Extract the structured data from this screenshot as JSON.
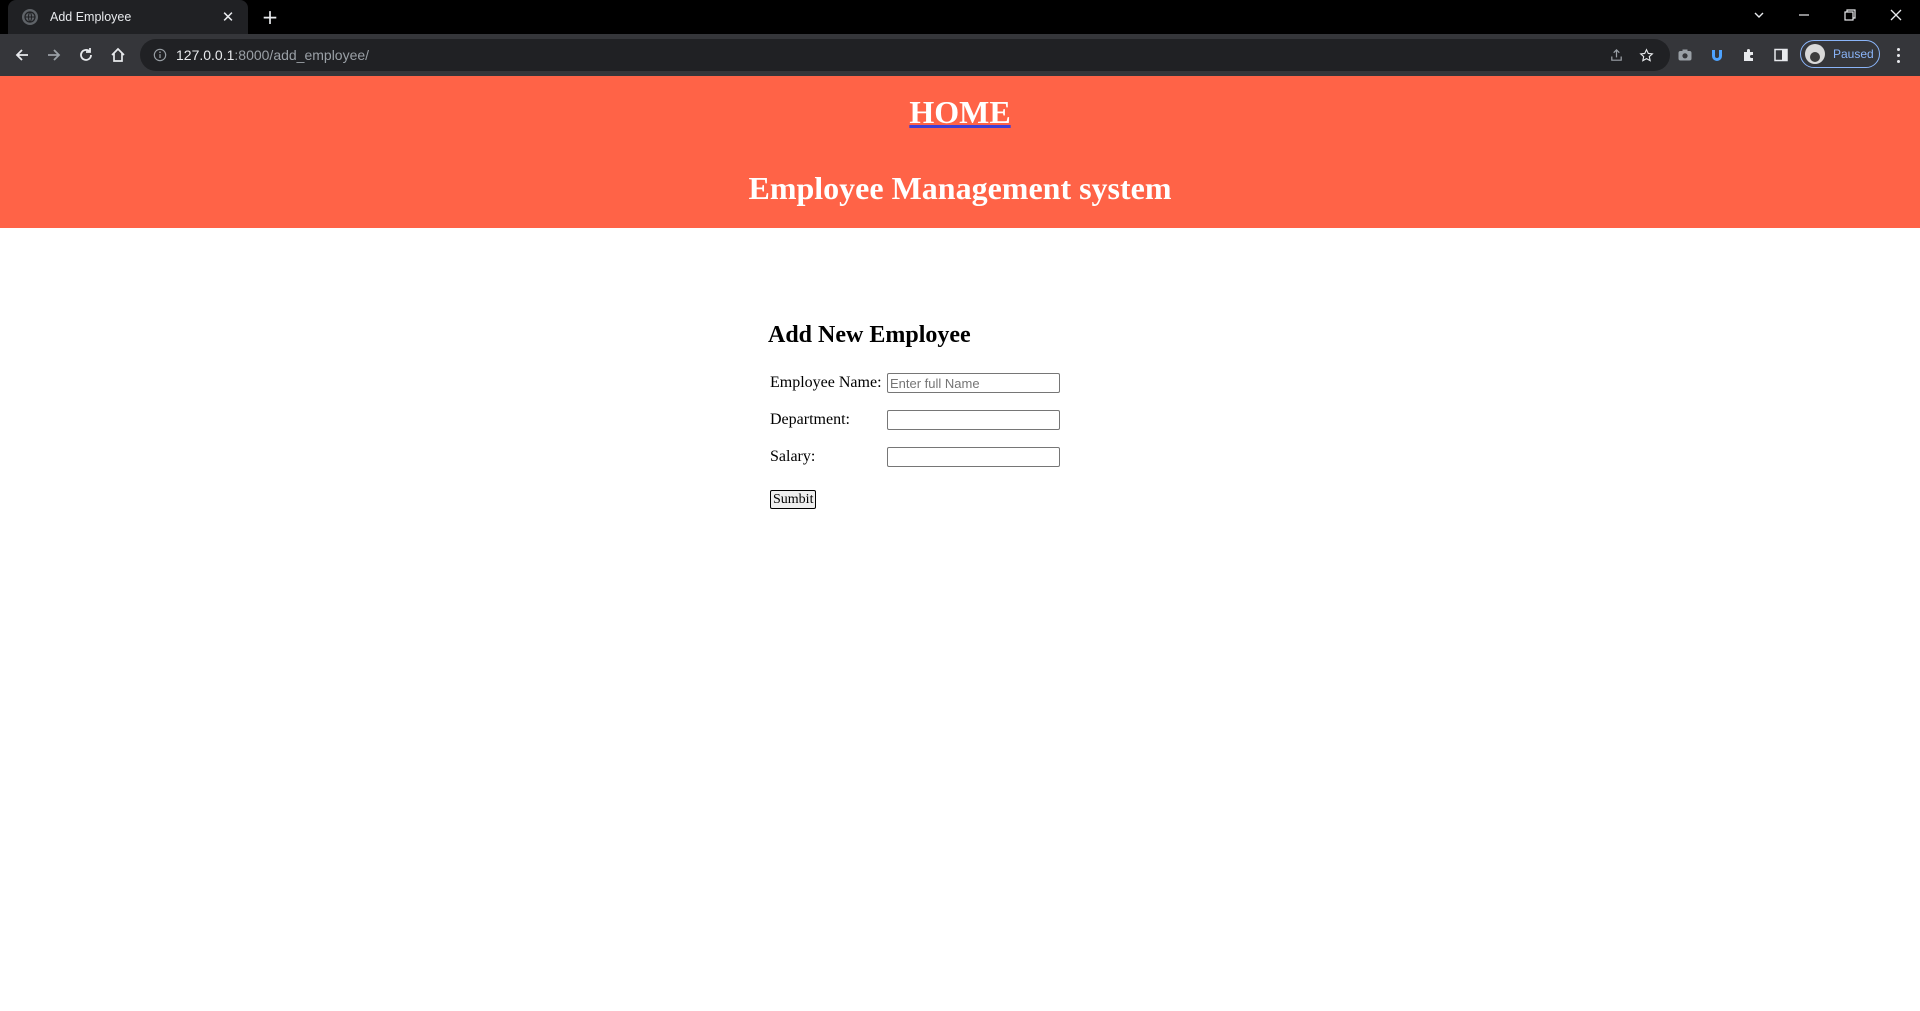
{
  "browser": {
    "tab_title": "Add Employee",
    "url_host": "127.0.0.1",
    "url_rest": ":8000/add_employee/",
    "profile_status": "Paused"
  },
  "header": {
    "home_link": "HOME",
    "site_title": "Employee Management system"
  },
  "form": {
    "heading": "Add New Employee",
    "fields": [
      {
        "label": "Employee Name:",
        "placeholder": "Enter full Name",
        "value": ""
      },
      {
        "label": "Department:",
        "placeholder": "",
        "value": ""
      },
      {
        "label": "Salary:",
        "placeholder": "",
        "value": ""
      }
    ],
    "submit_label": "Sumbit"
  },
  "colors": {
    "banner": "#ff6347",
    "banner_text": "#ffffff",
    "browser_frame": "#000000",
    "browser_toolbar": "#35363a"
  }
}
